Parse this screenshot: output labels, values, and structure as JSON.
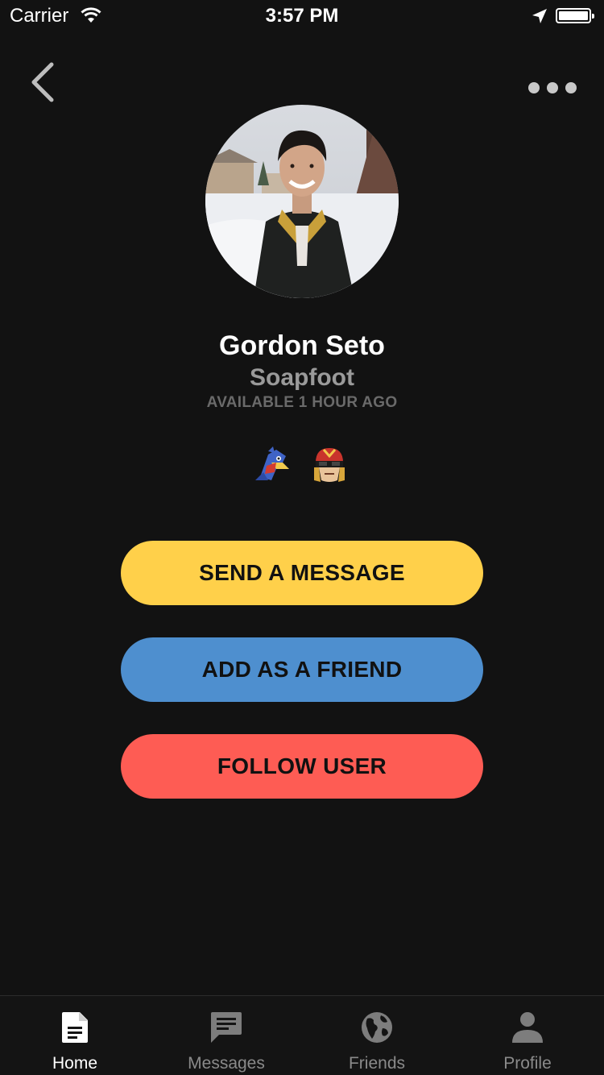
{
  "status_bar": {
    "carrier": "Carrier",
    "time": "3:57 PM"
  },
  "nav": {
    "back_icon": "chevron-left-icon",
    "more_icon": "more-horizontal-icon"
  },
  "profile": {
    "display_name": "Gordon Seto",
    "username": "Soapfoot",
    "availability": "AVAILABLE 1 HOUR AGO",
    "characters": [
      "falco-icon",
      "captain-falcon-icon"
    ]
  },
  "actions": {
    "send_message": "SEND A MESSAGE",
    "add_friend": "ADD AS A FRIEND",
    "follow_user": "FOLLOW USER"
  },
  "colors": {
    "background": "#121212",
    "send_message": "#FFD04A",
    "add_friend": "#4E8FCF",
    "follow_user": "#FE5C54"
  },
  "tab_bar": {
    "tabs": [
      {
        "label": "Home",
        "icon": "document-icon",
        "active": true
      },
      {
        "label": "Messages",
        "icon": "message-icon",
        "active": false
      },
      {
        "label": "Friends",
        "icon": "globe-icon",
        "active": false
      },
      {
        "label": "Profile",
        "icon": "person-icon",
        "active": false
      }
    ]
  }
}
